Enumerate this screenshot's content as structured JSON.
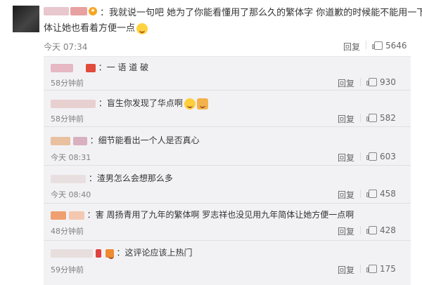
{
  "main_comment": {
    "text_line1": "：我就说一句吧  她为了你能看懂用了那么久的繁体字  你道歉的时候能不能用一下简",
    "text_line2": "体让她也看着方便一点",
    "time": "今天 07:34",
    "reply_label": "回复",
    "likes": "5646"
  },
  "replies": [
    {
      "text": "：一 语 道 破",
      "time": "58分钟前",
      "reply_label": "回复",
      "likes": "930"
    },
    {
      "text": "：盲生你发现了华点啊",
      "time": "58分钟前",
      "reply_label": "回复",
      "likes": "582"
    },
    {
      "text": "：细节能看出一个人是否真心",
      "time": "今天 08:31",
      "reply_label": "回复",
      "likes": "603"
    },
    {
      "text": "：渣男怎么会想那么多",
      "time": "今天 08:40",
      "reply_label": "回复",
      "likes": "458"
    },
    {
      "text": "：害 周扬青用了九年的繁体啊  罗志祥也没见用九年简体让她方便一点啊",
      "time": "48分钟前",
      "reply_label": "回复",
      "likes": "428"
    },
    {
      "text": "：这评论应该上热门",
      "time": "59分钟前",
      "reply_label": "回复",
      "likes": "175"
    }
  ],
  "colors": {
    "panel_bg": "#f2f2f5",
    "meta_text": "#808080",
    "avatar": "#2a2a2a"
  }
}
